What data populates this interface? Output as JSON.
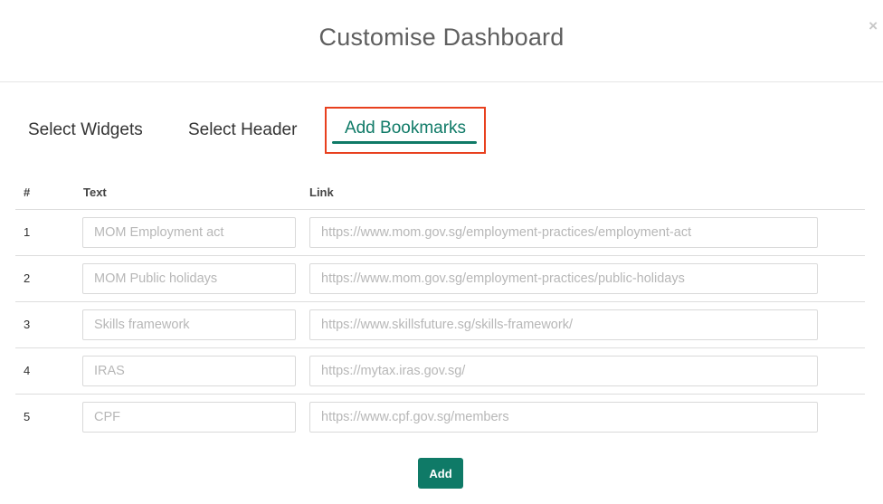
{
  "modal": {
    "title": "Customise Dashboard",
    "close_label": "×"
  },
  "tabs": [
    {
      "label": "Select Widgets",
      "active": false
    },
    {
      "label": "Select Header",
      "active": false
    },
    {
      "label": "Add Bookmarks",
      "active": true
    }
  ],
  "table": {
    "headers": {
      "num": "#",
      "text": "Text",
      "link": "Link"
    },
    "rows": [
      {
        "num": "1",
        "text_placeholder": "MOM Employment act",
        "link_placeholder": "https://www.mom.gov.sg/employment-practices/employment-act"
      },
      {
        "num": "2",
        "text_placeholder": "MOM Public holidays",
        "link_placeholder": "https://www.mom.gov.sg/employment-practices/public-holidays"
      },
      {
        "num": "3",
        "text_placeholder": "Skills framework",
        "link_placeholder": "https://www.skillsfuture.sg/skills-framework/"
      },
      {
        "num": "4",
        "text_placeholder": "IRAS",
        "link_placeholder": "https://mytax.iras.gov.sg/"
      },
      {
        "num": "5",
        "text_placeholder": "CPF",
        "link_placeholder": "https://www.cpf.gov.sg/members"
      }
    ]
  },
  "add_button": {
    "label": "Add"
  },
  "colors": {
    "accent": "#0f7a67",
    "highlight_border": "#e8401e",
    "title": "#5f5f5f",
    "placeholder": "#b7b7b7"
  }
}
